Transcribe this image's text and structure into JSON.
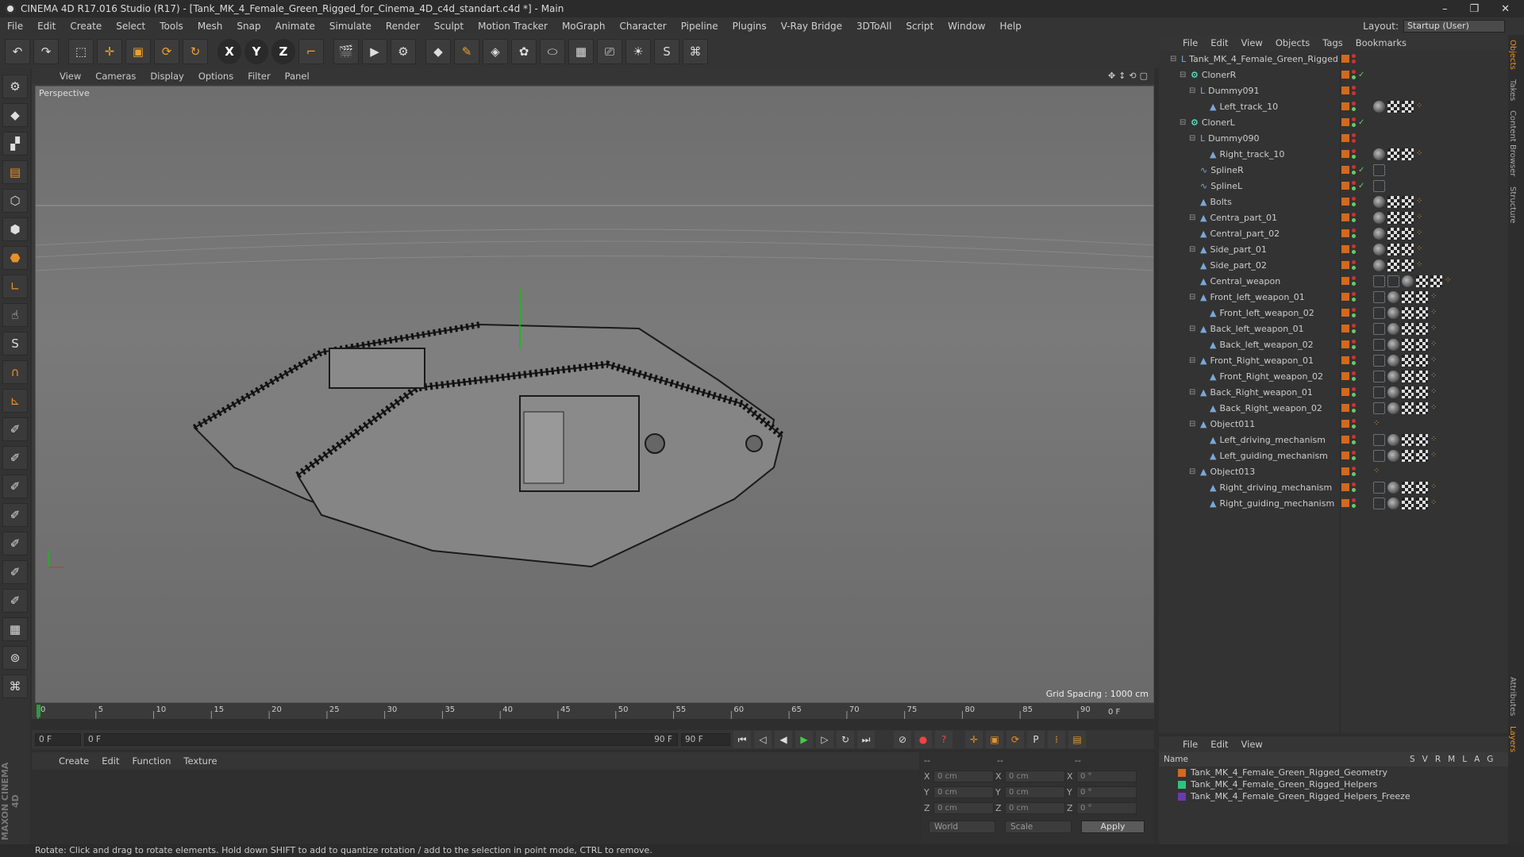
{
  "window": {
    "title": "CINEMA 4D R17.016 Studio (R17) - [Tank_MK_4_Female_Green_Rigged_for_Cinema_4D_c4d_standart.c4d *] - Main",
    "buttons": [
      "–",
      "❐",
      "✕"
    ]
  },
  "menu": [
    "File",
    "Edit",
    "Create",
    "Select",
    "Tools",
    "Mesh",
    "Snap",
    "Animate",
    "Simulate",
    "Render",
    "Sculpt",
    "Motion Tracker",
    "MoGraph",
    "Character",
    "Pipeline",
    "Plugins",
    "V-Ray Bridge",
    "3DToAll",
    "Script",
    "Window",
    "Help"
  ],
  "layout": {
    "label": "Layout:",
    "value": "Startup (User)"
  },
  "viewport": {
    "menu": [
      "View",
      "Cameras",
      "Display",
      "Options",
      "Filter",
      "Panel"
    ],
    "label": "Perspective",
    "grid_spacing": "Grid Spacing : 1000 cm"
  },
  "timeline": {
    "ticks": [
      "0",
      "5",
      "10",
      "15",
      "20",
      "25",
      "30",
      "35",
      "40",
      "45",
      "50",
      "55",
      "60",
      "65",
      "70",
      "75",
      "80",
      "85",
      "90"
    ],
    "end_field": "0 F"
  },
  "transport": {
    "start": "0 F",
    "range_start": "0 F",
    "range_end": "90 F",
    "end": "90 F"
  },
  "material": {
    "menu": [
      "Create",
      "Edit",
      "Function",
      "Texture"
    ]
  },
  "coords": {
    "rows": [
      {
        "a": "X",
        "v1": "0 cm",
        "b": "X",
        "v2": "0 cm",
        "c": "X",
        "v3": "0 °"
      },
      {
        "a": "Y",
        "v1": "0 cm",
        "b": "Y",
        "v2": "0 cm",
        "c": "Y",
        "v3": "0 °"
      },
      {
        "a": "Z",
        "v1": "0 cm",
        "b": "Z",
        "v2": "0 cm",
        "c": "Z",
        "v3": "0 °"
      }
    ],
    "mode": "World",
    "scale": "Scale",
    "apply": "Apply",
    "headers": [
      "--",
      "--",
      "--"
    ]
  },
  "status": "Rotate: Click and drag to rotate elements. Hold down SHIFT to add to quantize rotation / add to the selection in point mode, CTRL to remove.",
  "objects": {
    "menu": [
      "File",
      "Edit",
      "View",
      "Objects",
      "Tags",
      "Bookmarks"
    ],
    "items": [
      {
        "name": "Tank_MK_4_Female_Green_Rigged",
        "indent": 0,
        "icon": "null",
        "check": false,
        "tags": ""
      },
      {
        "name": "ClonerR",
        "indent": 1,
        "icon": "gen",
        "check": true,
        "tags": ""
      },
      {
        "name": "Dummy091",
        "indent": 2,
        "icon": "null",
        "check": false,
        "tags": ""
      },
      {
        "name": "Left_track_10",
        "indent": 3,
        "icon": "poly",
        "check": false,
        "tags": "mcco"
      },
      {
        "name": "ClonerL",
        "indent": 1,
        "icon": "gen",
        "check": true,
        "tags": ""
      },
      {
        "name": "Dummy090",
        "indent": 2,
        "icon": "null",
        "check": false,
        "tags": ""
      },
      {
        "name": "Right_track_10",
        "indent": 3,
        "icon": "poly",
        "check": false,
        "tags": "mcco"
      },
      {
        "name": "SplineR",
        "indent": 2,
        "icon": "spline",
        "check": true,
        "tags": "g"
      },
      {
        "name": "SplineL",
        "indent": 2,
        "icon": "spline",
        "check": true,
        "tags": "g"
      },
      {
        "name": "Bolts",
        "indent": 2,
        "icon": "poly",
        "check": false,
        "tags": "mcco"
      },
      {
        "name": "Centra_part_01",
        "indent": 2,
        "icon": "poly",
        "check": false,
        "tags": "mcco"
      },
      {
        "name": "Central_part_02",
        "indent": 2,
        "icon": "poly",
        "check": false,
        "tags": "mcco"
      },
      {
        "name": "Side_part_01",
        "indent": 2,
        "icon": "poly",
        "check": false,
        "tags": "mcco"
      },
      {
        "name": "Side_part_02",
        "indent": 2,
        "icon": "poly",
        "check": false,
        "tags": "mcco"
      },
      {
        "name": "Central_weapon",
        "indent": 2,
        "icon": "poly",
        "check": false,
        "tags": "ggmcco"
      },
      {
        "name": "Front_left_weapon_01",
        "indent": 2,
        "icon": "poly",
        "check": false,
        "tags": "gmcco"
      },
      {
        "name": "Front_left_weapon_02",
        "indent": 3,
        "icon": "poly",
        "check": false,
        "tags": "gmcco"
      },
      {
        "name": "Back_left_weapon_01",
        "indent": 2,
        "icon": "poly",
        "check": false,
        "tags": "gmcco"
      },
      {
        "name": "Back_left_weapon_02",
        "indent": 3,
        "icon": "poly",
        "check": false,
        "tags": "gmcco"
      },
      {
        "name": "Front_Right_weapon_01",
        "indent": 2,
        "icon": "poly",
        "check": false,
        "tags": "gmcco"
      },
      {
        "name": "Front_Right_weapon_02",
        "indent": 3,
        "icon": "poly",
        "check": false,
        "tags": "gmcco"
      },
      {
        "name": "Back_Right_weapon_01",
        "indent": 2,
        "icon": "poly",
        "check": false,
        "tags": "gmcco"
      },
      {
        "name": "Back_Right_weapon_02",
        "indent": 3,
        "icon": "poly",
        "check": false,
        "tags": "gmcco"
      },
      {
        "name": "Object011",
        "indent": 2,
        "icon": "poly",
        "check": false,
        "tags": "o"
      },
      {
        "name": "Left_driving_mechanism",
        "indent": 3,
        "icon": "poly",
        "check": false,
        "tags": "gmcco"
      },
      {
        "name": "Left_guiding_mechanism",
        "indent": 3,
        "icon": "poly",
        "check": false,
        "tags": "gmcco"
      },
      {
        "name": "Object013",
        "indent": 2,
        "icon": "poly",
        "check": false,
        "tags": "o"
      },
      {
        "name": "Right_driving_mechanism",
        "indent": 3,
        "icon": "poly",
        "check": false,
        "tags": "gmcco"
      },
      {
        "name": "Right_guiding_mechanism",
        "indent": 3,
        "icon": "poly",
        "check": false,
        "tags": "gmcco"
      }
    ]
  },
  "layers": {
    "menu": [
      "File",
      "Edit",
      "View"
    ],
    "header": {
      "name": "Name",
      "cols": [
        "S",
        "V",
        "R",
        "M",
        "L",
        "A",
        "G"
      ]
    },
    "items": [
      {
        "name": "Tank_MK_4_Female_Green_Rigged_Geometry",
        "color": "#d2691e"
      },
      {
        "name": "Tank_MK_4_Female_Green_Rigged_Helpers",
        "color": "#2ec27e"
      },
      {
        "name": "Tank_MK_4_Female_Green_Rigged_Helpers_Freeze",
        "color": "#6a3ab0"
      }
    ]
  },
  "right_tabs": [
    "Objects",
    "Takes",
    "Content Browser",
    "Structure",
    "Attributes",
    "Layers"
  ],
  "logo": "MAXON CINEMA 4D"
}
